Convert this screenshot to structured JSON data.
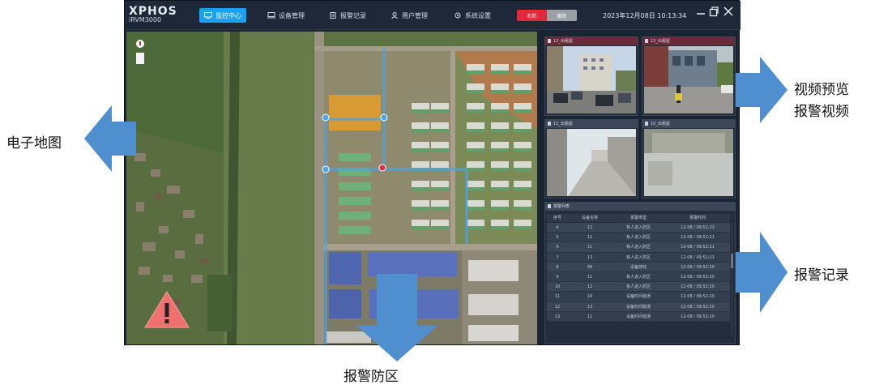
{
  "app": {
    "brand": "XPHOS",
    "model": "iRVM3000",
    "nav": [
      {
        "label": "监控中心",
        "active": true,
        "icon": "monitor-icon"
      },
      {
        "label": "设备管理",
        "active": false,
        "icon": "device-icon"
      },
      {
        "label": "报警记录",
        "active": false,
        "icon": "clipboard-icon"
      },
      {
        "label": "用户管理",
        "active": false,
        "icon": "user-icon"
      },
      {
        "label": "系统设置",
        "active": false,
        "icon": "gear-icon"
      }
    ],
    "arm_toggle": {
      "on": "布防",
      "off": "撤防"
    },
    "datetime": "2023年12月08日 10:13:34"
  },
  "videos": [
    {
      "title": "12_出租屋",
      "highlight": true
    },
    {
      "title": "13_出租屋",
      "highlight": true
    },
    {
      "title": "11_出租屋",
      "highlight": false
    },
    {
      "title": "10_出租屋",
      "highlight": false
    }
  ],
  "alarm_table": {
    "title": "报警列表",
    "headers": [
      "序号",
      "设备名称",
      "报警类型",
      "报警时间"
    ],
    "rows": [
      [
        "4",
        "12",
        "有人进入防区",
        "12-08 / 09:52:23"
      ],
      [
        "5",
        "11",
        "有人进入防区",
        "12-08 / 09:52:21"
      ],
      [
        "6",
        "11",
        "有人进入防区",
        "12-08 / 09:52:21"
      ],
      [
        "7",
        "13",
        "有人进入防区",
        "12-08 / 09:52:21"
      ],
      [
        "8",
        "99",
        "设备掉线",
        "12-08 / 09:52:20"
      ],
      [
        "9",
        "11",
        "有人进入防区",
        "12-08 / 09:52:20"
      ],
      [
        "10",
        "12",
        "有人进入防区",
        "12-08 / 09:52:20"
      ],
      [
        "11",
        "16",
        "设备时间错误",
        "12-08 / 09:52:20"
      ],
      [
        "12",
        "13",
        "设备时间错误",
        "12-08 / 09:52:20"
      ],
      [
        "13",
        "11",
        "设备时间错误",
        "12-08 / 09:52:20"
      ]
    ]
  },
  "annotations": {
    "map": "电子地图",
    "video_line1": "视频预览",
    "video_line2": "报警视频",
    "records": "报警记录",
    "zone": "报警防区"
  },
  "colors": {
    "accent": "#1aa1f0",
    "alarm_red": "#e02a3c",
    "arrow": "#4f8fd0"
  }
}
